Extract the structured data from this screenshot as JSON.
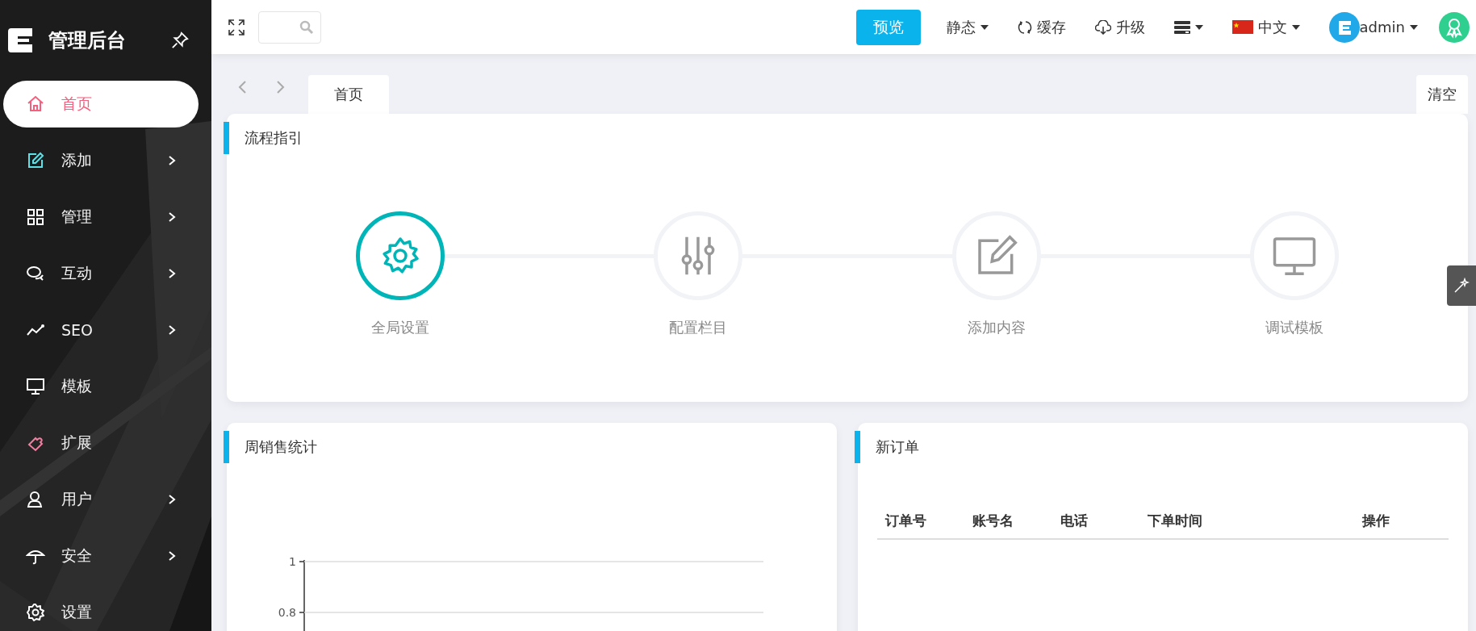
{
  "sidebar": {
    "title": "管理后台",
    "items": [
      {
        "label": "首页",
        "selected": true,
        "has_arrow": false
      },
      {
        "label": "添加",
        "selected": false,
        "has_arrow": true
      },
      {
        "label": "管理",
        "selected": false,
        "has_arrow": true
      },
      {
        "label": "互动",
        "selected": false,
        "has_arrow": true
      },
      {
        "label": "SEO",
        "selected": false,
        "has_arrow": true
      },
      {
        "label": "模板",
        "selected": false,
        "has_arrow": false
      },
      {
        "label": "扩展",
        "selected": false,
        "has_arrow": false
      },
      {
        "label": "用户",
        "selected": false,
        "has_arrow": true
      },
      {
        "label": "安全",
        "selected": false,
        "has_arrow": true
      },
      {
        "label": "设置",
        "selected": false,
        "has_arrow": false
      }
    ]
  },
  "topbar": {
    "preview_button": "预览",
    "static_menu": "静态",
    "cache_button": "缓存",
    "upgrade_button": "升级",
    "language": "中文",
    "user": "admin"
  },
  "tabs": [
    {
      "label": "首页",
      "selected": true
    }
  ],
  "clear_button": "清空",
  "guide": {
    "title": "流程指引",
    "steps": [
      {
        "label": "全局设置",
        "active": true
      },
      {
        "label": "配置栏目",
        "active": false
      },
      {
        "label": "添加内容",
        "active": false
      },
      {
        "label": "调试模板",
        "active": false
      }
    ]
  },
  "sales": {
    "title": "周销售统计",
    "y_axis_labels": [
      "1",
      "0.8"
    ]
  },
  "orders": {
    "title": "新订单",
    "columns": [
      "订单号",
      "账号名",
      "电话",
      "下单时间",
      "操作"
    ]
  }
}
